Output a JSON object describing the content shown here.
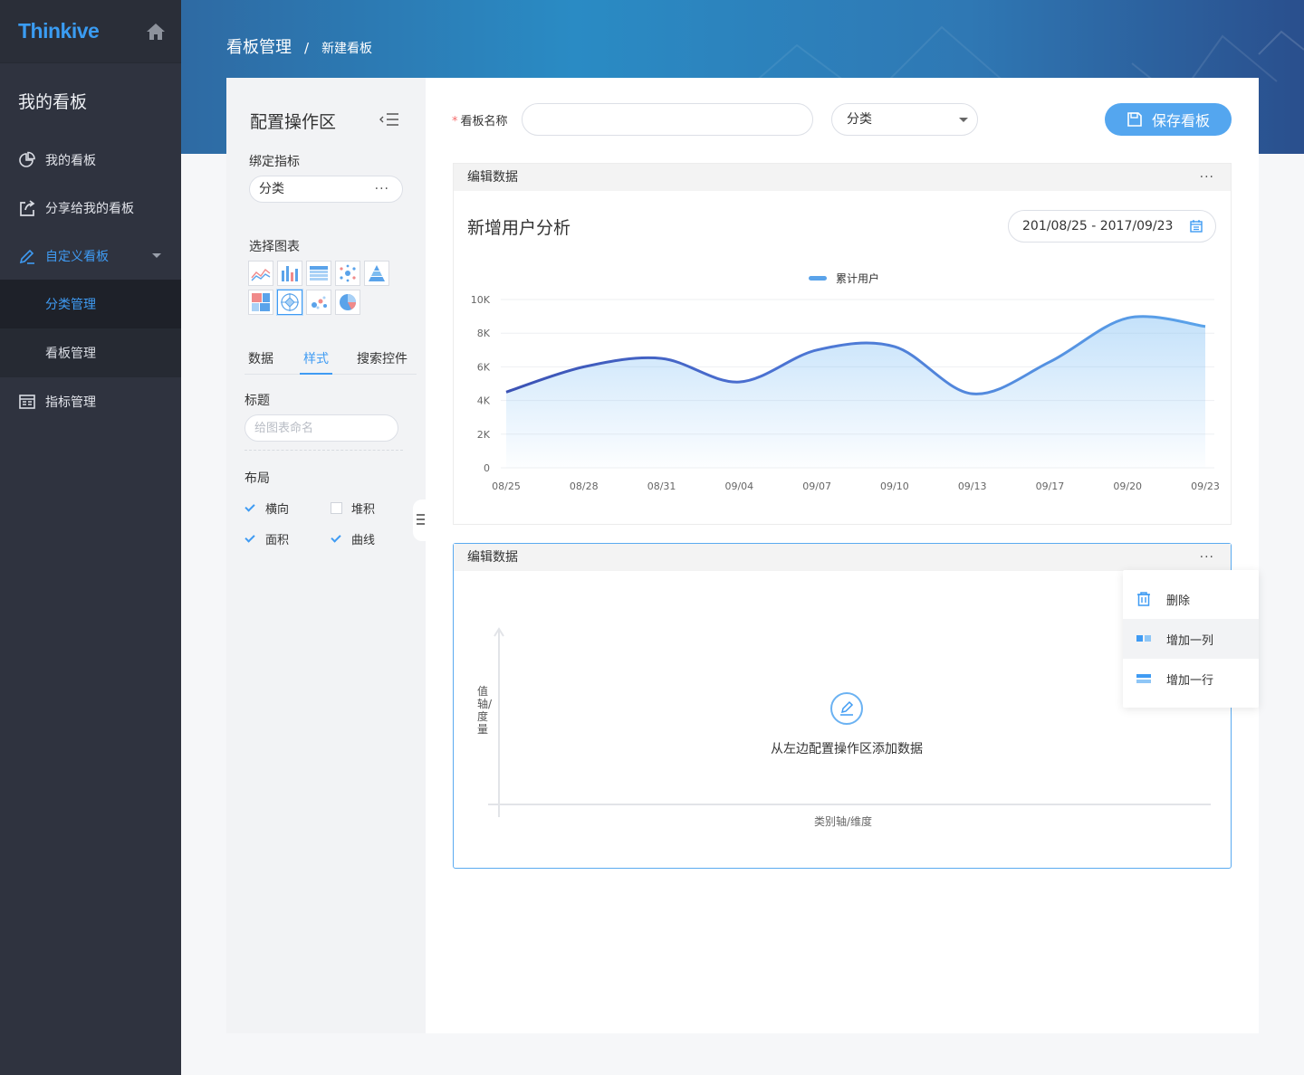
{
  "sidebar": {
    "logo": "Thinkive",
    "title": "我的看板",
    "menu": [
      {
        "label": "我的看板"
      },
      {
        "label": "分享给我的看板"
      },
      {
        "label": "自定义看板"
      },
      {
        "label": "指标管理"
      }
    ],
    "submenu": [
      {
        "label": "分类管理"
      },
      {
        "label": "看板管理"
      }
    ]
  },
  "breadcrumb": {
    "main": "看板管理",
    "separator": "/",
    "current": "新建看板"
  },
  "config": {
    "title": "配置操作区",
    "bind_label": "绑定指标",
    "bind_value": "分类",
    "bind_more": "···",
    "chart_label": "选择图表",
    "tabs": [
      "数据",
      "样式",
      "搜索控件"
    ],
    "title_label": "标题",
    "title_placeholder": "给图表命名",
    "layout_label": "布局",
    "options": [
      {
        "label": "横向",
        "checked": true
      },
      {
        "label": "堆积",
        "checked": false
      },
      {
        "label": "面积",
        "checked": true
      },
      {
        "label": "曲线",
        "checked": true
      }
    ]
  },
  "form": {
    "required_mark": "*",
    "name_label": "看板名称",
    "name_value": "",
    "category_value": "分类",
    "save_label": "保存看板"
  },
  "card1": {
    "header": "编辑数据",
    "more": "···",
    "title": "新增用户分析",
    "date_range": "201/08/25 - 2017/09/23"
  },
  "card2": {
    "header": "编辑数据",
    "more": "···",
    "empty_text": "从左边配置操作区添加数据",
    "y_axis": "值轴/度量",
    "x_axis": "类别轴/维度"
  },
  "context_menu": [
    {
      "label": "删除",
      "icon": "trash-icon"
    },
    {
      "label": "增加一列",
      "icon": "add-column-icon"
    },
    {
      "label": "增加一行",
      "icon": "add-row-icon"
    }
  ],
  "colors": {
    "accent": "#3f9bf3",
    "sidebar_bg": "#2f333f",
    "line": "#5aa3ea"
  },
  "chart_data": {
    "type": "area",
    "title": "新增用户分析",
    "x": [
      "08/25",
      "08/28",
      "08/31",
      "09/04",
      "09/07",
      "09/10",
      "09/13",
      "09/17",
      "09/20",
      "09/23"
    ],
    "series": [
      {
        "name": "累计用户",
        "values": [
          4500,
          6000,
          6500,
          5100,
          7000,
          7200,
          4400,
          6300,
          8900,
          8400
        ]
      }
    ],
    "y_ticks": [
      "0",
      "2K",
      "4K",
      "6K",
      "8K",
      "10K"
    ],
    "ylim": [
      0,
      10000
    ],
    "legend": "top-center",
    "grid": true
  }
}
